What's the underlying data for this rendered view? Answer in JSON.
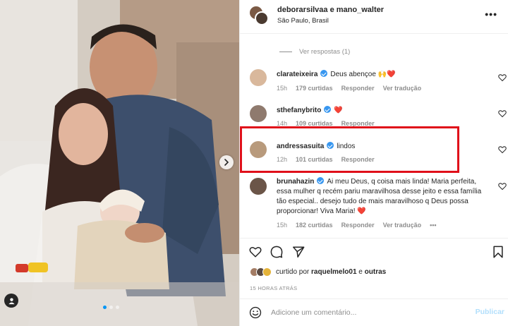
{
  "post": {
    "header": {
      "usernames": "deborarsilvaa e mano_walter",
      "location": "São Paulo, Brasil",
      "more": "•••"
    },
    "photo": {
      "carousel_dots": 3,
      "active_dot": 0
    },
    "view_replies": "Ver respostas (1)",
    "comments": [
      {
        "user": "clarateixeira",
        "verified": true,
        "text": "Deus abençoe 🙌❤️",
        "time": "15h",
        "likes": "179 curtidas",
        "reply": "Responder",
        "translate": "Ver tradução"
      },
      {
        "user": "sthefanybrito",
        "verified": true,
        "text": "❤️",
        "time": "14h",
        "likes": "109 curtidas",
        "reply": "Responder",
        "translate": ""
      },
      {
        "user": "andressasuita",
        "verified": true,
        "text": "lindos",
        "time": "12h",
        "likes": "101 curtidas",
        "reply": "Responder",
        "translate": ""
      },
      {
        "user": "brunahazin",
        "verified": true,
        "text": "Ai meu Deus, q coisa mais linda! Maria perfeita, essa mulher q recém pariu maravilhosa desse jeito e essa família tão especial.. desejo tudo de mais maravilhoso q Deus possa proporcionar! Viva Maria! ❤️",
        "time": "15h",
        "likes": "182 curtidas",
        "reply": "Responder",
        "translate": "Ver tradução",
        "more": "•••"
      }
    ],
    "liked_by": {
      "prefix": "curtido por ",
      "user": "raquelmelo01",
      "connector": " e ",
      "others": "outras"
    },
    "time_ago": "15 HORAS ATRÁS",
    "add_comment": {
      "placeholder": "Adicione um comentário...",
      "publish": "Publicar"
    }
  },
  "colors": {
    "highlight": "#e0101a",
    "verified": "#3897f0",
    "publish_disabled": "#b2dffc",
    "muted": "#8e8e8e"
  }
}
